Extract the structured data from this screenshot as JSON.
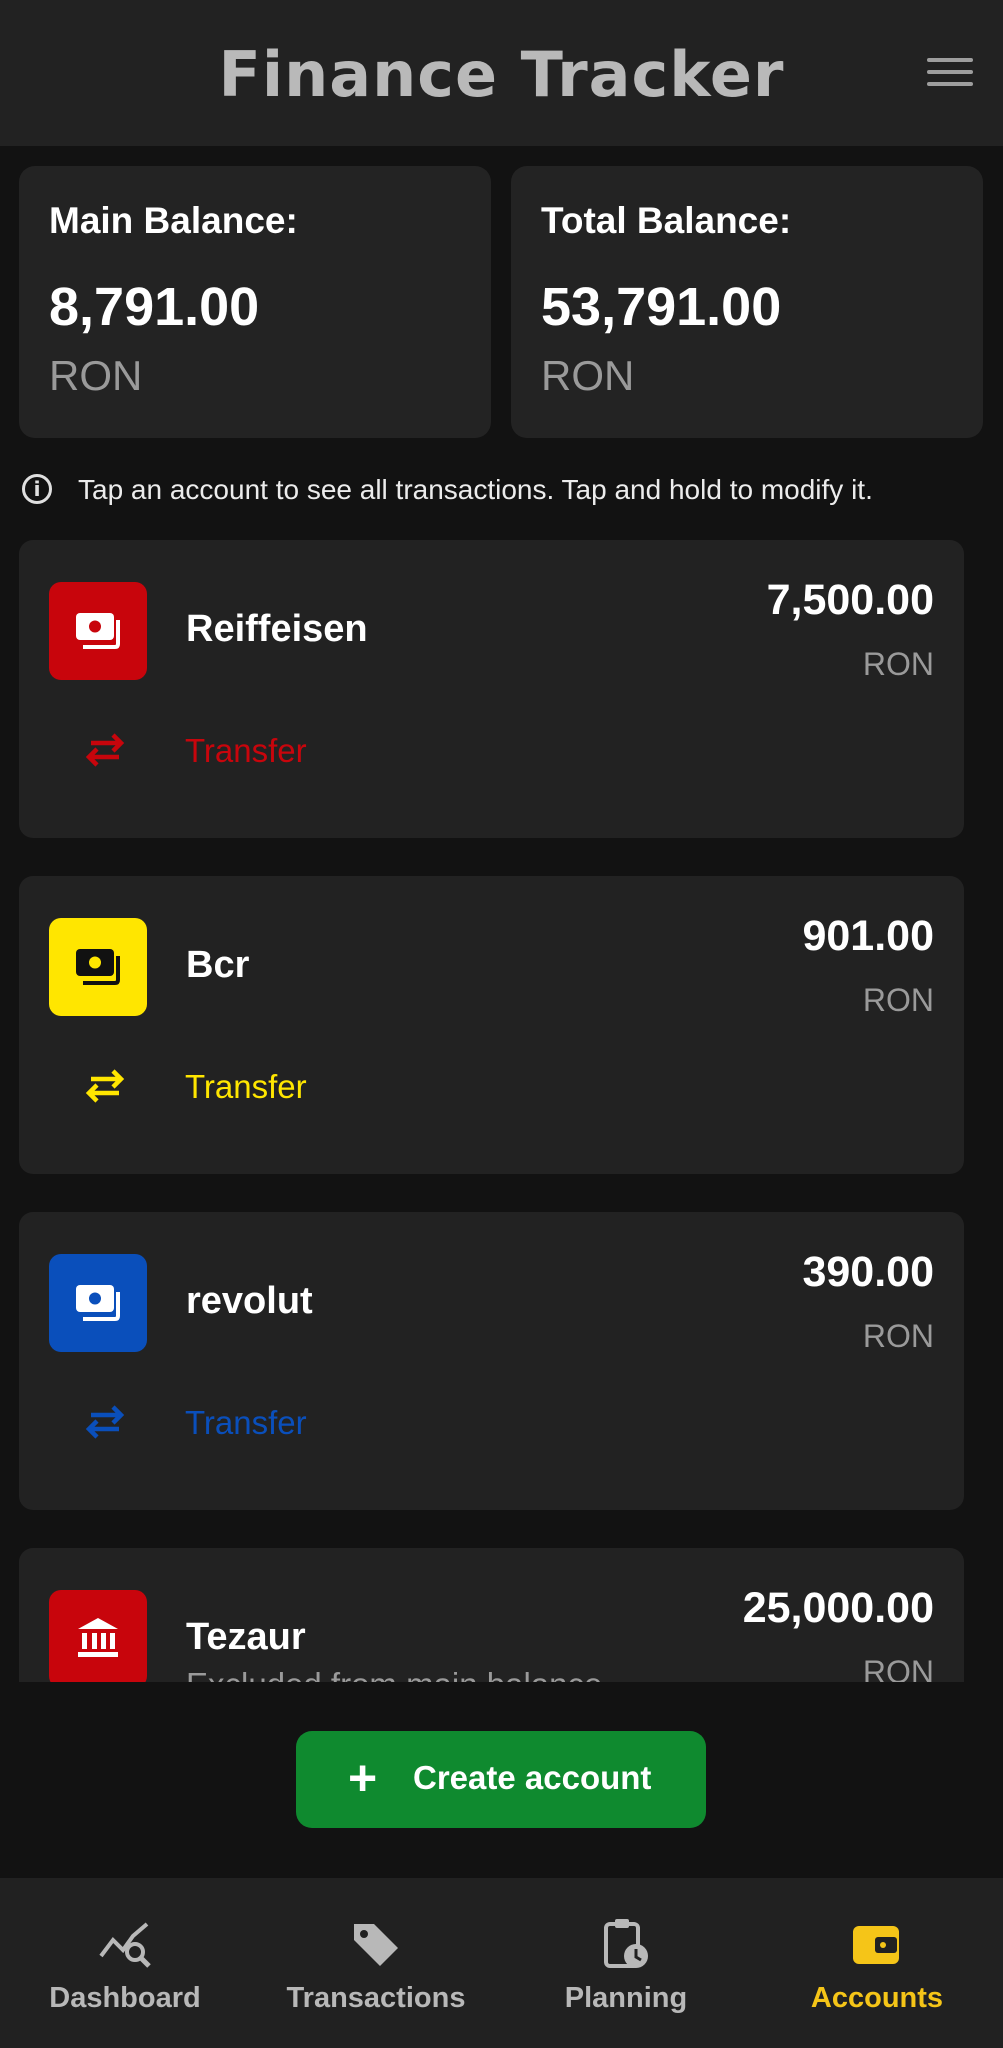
{
  "app": {
    "title": "Finance Tracker"
  },
  "balances": {
    "main": {
      "label": "Main Balance:",
      "value": "8,791.00",
      "currency": "RON"
    },
    "total": {
      "label": "Total Balance:",
      "value": "53,791.00",
      "currency": "RON"
    }
  },
  "info": {
    "text": "Tap an account to see all transactions. Tap and hold to modify it."
  },
  "accounts": [
    {
      "name": "Reiffeisen",
      "amount": "7,500.00",
      "currency": "RON",
      "color": "#c8050c",
      "icon": "wallet-icon",
      "action": "Transfer"
    },
    {
      "name": "Bcr",
      "amount": "901.00",
      "currency": "RON",
      "color": "#ffe600",
      "icon": "wallet-icon",
      "action": "Transfer"
    },
    {
      "name": "revolut",
      "amount": "390.00",
      "currency": "RON",
      "color": "#0a4fbb",
      "icon": "wallet-icon",
      "action": "Transfer"
    },
    {
      "name": "Tezaur",
      "subtitle": "Excluded from main balance",
      "amount": "25,000.00",
      "currency": "RON",
      "color": "#c8050c",
      "icon": "bank-icon"
    }
  ],
  "create_button": {
    "label": "Create account",
    "color": "#0f8a2f"
  },
  "nav": {
    "active": "Accounts",
    "active_color": "#f5c518",
    "items": [
      {
        "label": "Dashboard",
        "icon": "chart-search-icon"
      },
      {
        "label": "Transactions",
        "icon": "tag-icon"
      },
      {
        "label": "Planning",
        "icon": "clipboard-clock-icon"
      },
      {
        "label": "Accounts",
        "icon": "wallet-icon"
      }
    ]
  }
}
